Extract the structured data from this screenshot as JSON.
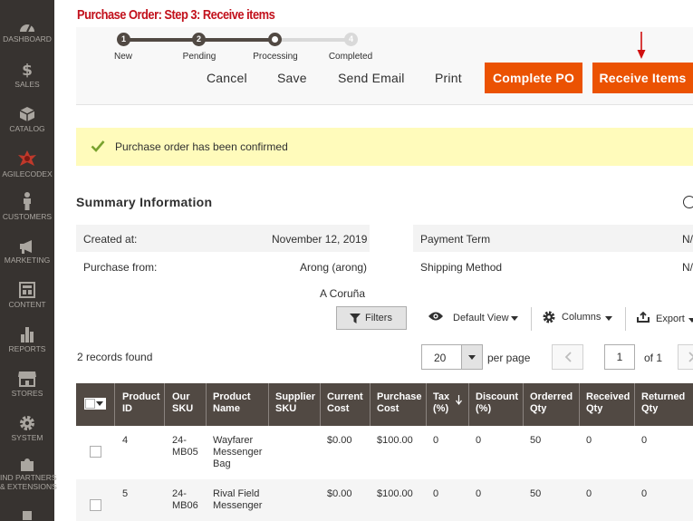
{
  "sidebar": {
    "items": [
      {
        "label": "DASHBOARD",
        "icon": "dashboard-icon"
      },
      {
        "label": "SALES",
        "icon": "dollar-icon"
      },
      {
        "label": "CATALOG",
        "icon": "box-icon"
      },
      {
        "label": "AGILECODEX",
        "icon": "agilecodex-logo-icon"
      },
      {
        "label": "CUSTOMERS",
        "icon": "person-icon"
      },
      {
        "label": "MARKETING",
        "icon": "megaphone-icon"
      },
      {
        "label": "CONTENT",
        "icon": "layout-icon"
      },
      {
        "label": "REPORTS",
        "icon": "bar-chart-icon"
      },
      {
        "label": "STORES",
        "icon": "store-icon"
      },
      {
        "label": "SYSTEM",
        "icon": "gear-icon"
      },
      {
        "label_line1": "IND PARTNERS",
        "label_line2": "& EXTENSIONS",
        "icon": "puzzle-icon"
      }
    ]
  },
  "annotation_title": "Purchase Order: Step 3: Receive items",
  "steps": [
    {
      "number": "1",
      "label": "New",
      "state": "done"
    },
    {
      "number": "2",
      "label": "Pending",
      "state": "done"
    },
    {
      "number": "",
      "label": "Processing",
      "state": "current"
    },
    {
      "number": "4",
      "label": "Completed",
      "state": "todo"
    }
  ],
  "actions": {
    "cancel": "Cancel",
    "save": "Save",
    "send_email": "Send Email",
    "print": "Print",
    "complete_po": "Complete PO",
    "receive_items": "Receive Items"
  },
  "message": {
    "text": "Purchase order has been confirmed",
    "color": "#fffbbb"
  },
  "summary": {
    "title": "Summary Information",
    "created_at_label": "Created at:",
    "created_at_value": "November 12, 2019",
    "purchase_from_label": "Purchase from:",
    "purchase_from_value": "Arong (arong)",
    "purchase_from_city": "A Coruña",
    "payment_term_label": "Payment Term",
    "payment_term_value": "N/",
    "shipping_method_label": "Shipping Method",
    "shipping_method_value": "N/"
  },
  "grid_toolbar": {
    "filters": "Filters",
    "view": "Default View",
    "columns": "Columns",
    "export": "Export",
    "records_found": "2 records found",
    "per_page_value": "20",
    "per_page_label": "per page",
    "page_current": "1",
    "page_of": "of 1"
  },
  "table": {
    "columns": [
      {
        "line1": "Product",
        "line2": "ID"
      },
      {
        "line1": "Our",
        "line2": "SKU"
      },
      {
        "line1": "Product",
        "line2": "Name"
      },
      {
        "line1": "Supplier",
        "line2": "SKU"
      },
      {
        "line1": "Current",
        "line2": "Cost"
      },
      {
        "line1": "Purchase",
        "line2": "Cost"
      },
      {
        "line1": "Tax",
        "line2": "(%)"
      },
      {
        "line1": "Discount",
        "line2": "(%)"
      },
      {
        "line1": "Orderred",
        "line2": "Qty"
      },
      {
        "line1": "Received",
        "line2": "Qty"
      },
      {
        "line1": "Returned",
        "line2": "Qty"
      }
    ],
    "rows": [
      {
        "product_id": "4",
        "sku_l1": "24-",
        "sku_l2": "MB05",
        "name_l1": "Wayfarer",
        "name_l2": "Messenger",
        "name_l3": "Bag",
        "supplier_sku": "",
        "current_cost": "$0.00",
        "purchase_cost": "$100.00",
        "tax": "0",
        "discount": "0",
        "ordered": "50",
        "received": "0",
        "returned": "0"
      },
      {
        "product_id": "5",
        "sku_l1": "24-",
        "sku_l2": "MB06",
        "name_l1": "Rival Field",
        "name_l2": "Messenger",
        "name_l3": "",
        "supplier_sku": "",
        "current_cost": "$0.00",
        "purchase_cost": "$100.00",
        "tax": "0",
        "discount": "0",
        "ordered": "50",
        "received": "0",
        "returned": "0"
      }
    ]
  },
  "colors": {
    "accent": "#eb5202",
    "sidebar": "#373330",
    "table_header": "#514943",
    "annotation": "#c2111c"
  }
}
